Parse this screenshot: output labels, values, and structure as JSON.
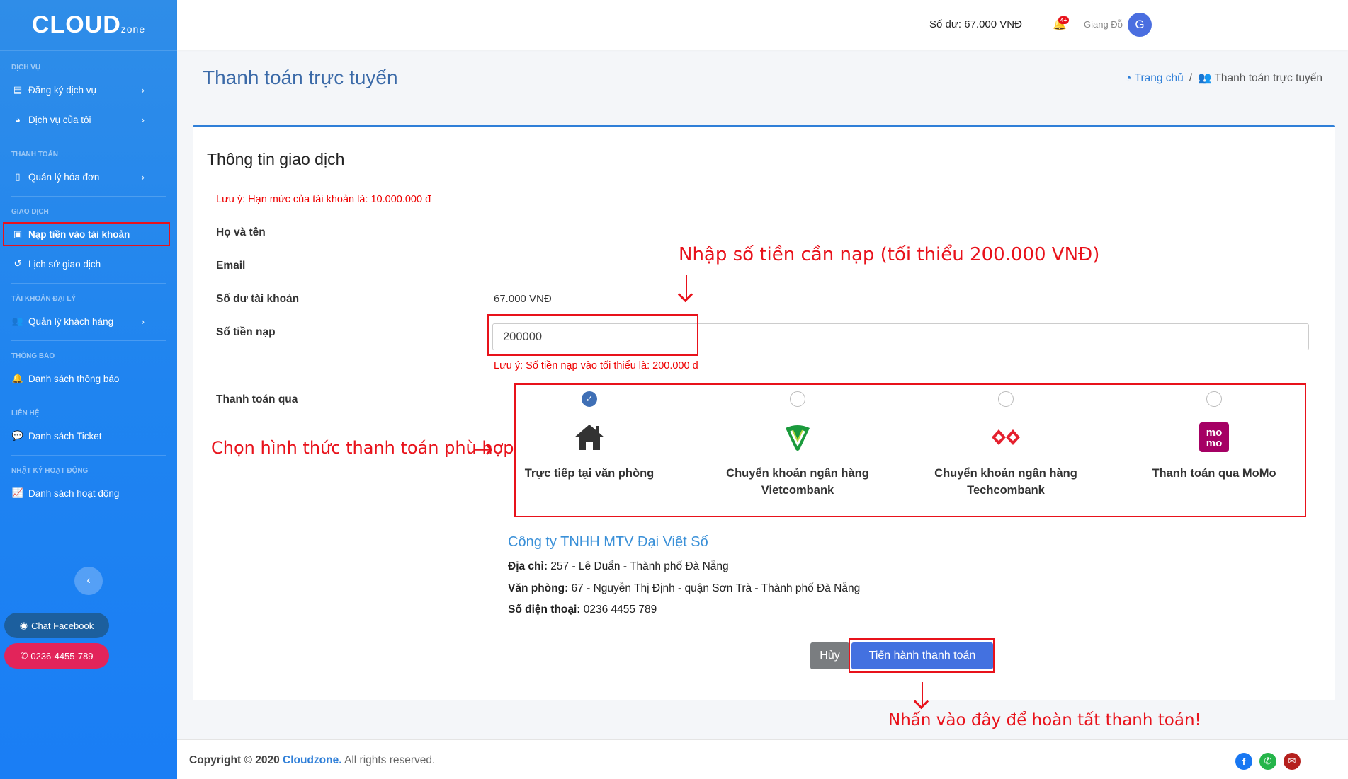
{
  "sidebar": {
    "logo": {
      "main": "CLOUD",
      "sub": "zone"
    },
    "sections": [
      {
        "title": "DỊCH VỤ",
        "items": [
          {
            "label": "Đăng ký dịch vụ",
            "icon": "store-icon",
            "chevron": true
          },
          {
            "label": "Dịch vụ của tôi",
            "icon": "chart-pie-icon",
            "chevron": true
          }
        ]
      },
      {
        "title": "THANH TOÁN",
        "items": [
          {
            "label": "Quản lý hóa đơn",
            "icon": "file-icon",
            "chevron": true
          }
        ]
      },
      {
        "title": "GIAO DỊCH",
        "items": [
          {
            "label": "Nạp tiền vào tài khoản",
            "icon": "wallet-icon",
            "chevron": false,
            "active": true
          },
          {
            "label": "Lịch sử giao dịch",
            "icon": "history-icon",
            "chevron": false
          }
        ]
      },
      {
        "title": "TÀI KHOẢN ĐẠI LÝ",
        "items": [
          {
            "label": "Quản lý khách hàng",
            "icon": "users-icon",
            "chevron": true
          }
        ]
      },
      {
        "title": "THÔNG BÁO",
        "items": [
          {
            "label": "Danh sách thông báo",
            "icon": "bell-icon",
            "chevron": false
          }
        ]
      },
      {
        "title": "LIÊN HỆ",
        "items": [
          {
            "label": "Danh sách Ticket",
            "icon": "comments-icon",
            "chevron": false
          }
        ]
      },
      {
        "title": "NHẬT KÝ HOẠT ĐỘNG",
        "items": [
          {
            "label": "Danh sách hoạt động",
            "icon": "chart-line-icon",
            "chevron": false
          }
        ]
      }
    ],
    "chat_facebook": "Chat Facebook",
    "phone": "0236-4455-789"
  },
  "topbar": {
    "balance": "Số dư: 67.000 VNĐ",
    "notification_badge": "4+",
    "username": "Giang Đỗ",
    "avatar_letter": "G"
  },
  "header": {
    "title": "Thanh toán trực tuyến",
    "breadcrumb_home": "Trang chủ",
    "breadcrumb_sep": "/",
    "breadcrumb_current": "Thanh toán trực tuyến"
  },
  "form": {
    "card_title": "Thông tin giao dịch",
    "limit_note": "Lưu ý: Hạn mức của tài khoản là: 10.000.000 đ",
    "name_label": "Họ và tên",
    "email_label": "Email",
    "balance_label": "Số dư tài khoản",
    "balance_value": "67.000 VNĐ",
    "amount_label": "Số tiền nạp",
    "amount_value": "200000",
    "amount_note": "Lưu ý: Số tiền nạp vào tối thiểu là: 200.000 đ",
    "pay_via_label": "Thanh toán qua",
    "payment_options": [
      {
        "label": "Trực tiếp tại văn phòng",
        "icon": "home-icon",
        "checked": true
      },
      {
        "label": "Chuyển khoản ngân hàng Vietcombank",
        "icon": "vietcombank-logo-icon",
        "checked": false
      },
      {
        "label": "Chuyển khoản ngân hàng Techcombank",
        "icon": "techcombank-logo-icon",
        "checked": false
      },
      {
        "label": "Thanh toán qua MoMo",
        "icon": "momo-logo-icon",
        "checked": false
      }
    ],
    "company_name": "Công ty TNHH MTV Đại Việt Số",
    "address_label": "Địa chỉ:",
    "address_value": " 257 - Lê Duẩn - Thành phố Đà Nẵng",
    "office_label": "Văn phòng:",
    "office_value": " 67 - Nguyễn Thị Định - quận Sơn Trà - Thành phố Đà Nẵng",
    "phone_label": "Số điện thoại:",
    "phone_value": " 0236 4455 789",
    "cancel_button": "Hủy",
    "pay_button": "Tiến hành thanh toán"
  },
  "annotations": {
    "enter_amount": "Nhập số tiền cần nạp (tối thiểu 200.000 VNĐ)",
    "choose_method": "Chọn hình thức thanh toán phù hợp",
    "click_here": "Nhấn vào đây để hoàn tất thanh toán!",
    "color": "#e8121b"
  },
  "footer": {
    "copyright_prefix": "Copyright © 2020 ",
    "brand": "Cloudzone.",
    "suffix": " All rights reserved."
  },
  "colors": {
    "sidebar": "#1f84f0",
    "primary": "#4371e0",
    "title": "#3b6aa8"
  }
}
